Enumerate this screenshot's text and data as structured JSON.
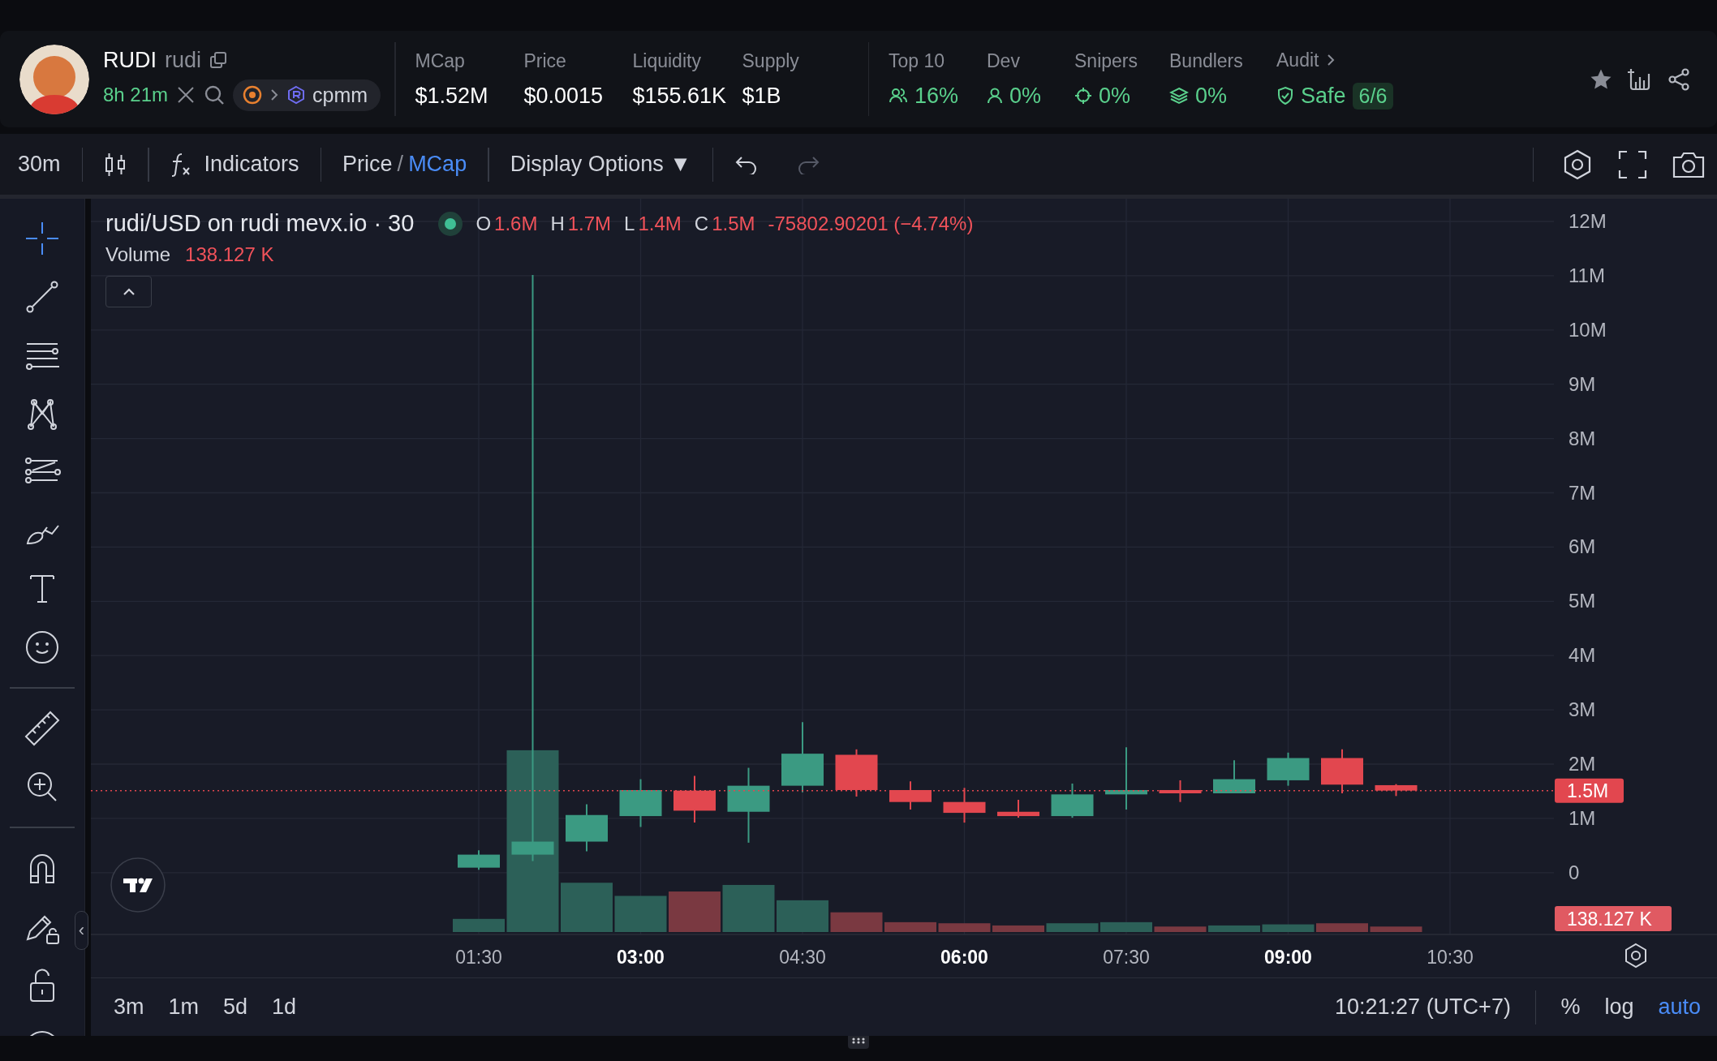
{
  "token": {
    "symbol": "RUDI",
    "name": "rudi",
    "age": "8h 21m",
    "pool": "cpmm"
  },
  "market_stats": [
    {
      "label": "MCap",
      "value": "$1.52M"
    },
    {
      "label": "Price",
      "value": "$0.0015"
    },
    {
      "label": "Liquidity",
      "value": "$155.61K"
    },
    {
      "label": "Supply",
      "value": "$1B"
    }
  ],
  "holder_stats": [
    {
      "label": "Top 10",
      "value": "16%"
    },
    {
      "label": "Dev",
      "value": "0%"
    },
    {
      "label": "Snipers",
      "value": "0%"
    },
    {
      "label": "Bundlers",
      "value": "0%"
    }
  ],
  "audit": {
    "label": "Audit",
    "status": "Safe",
    "score": "6/6"
  },
  "toolbar": {
    "interval": "30m",
    "indicators": "Indicators",
    "price_mode_separator": "/",
    "price_mode": [
      {
        "label": "Price",
        "selected": false
      },
      {
        "label": "MCap",
        "selected": true
      }
    ],
    "display_options": "Display Options ▼",
    "undo": {
      "disabled": false
    },
    "redo": {
      "disabled": true
    }
  },
  "drawing_tool_groups": [
    {
      "tools": [
        {
          "selected": true
        },
        {
          "selected": false
        },
        {
          "selected": false
        },
        {
          "selected": false
        },
        {
          "selected": false
        },
        {
          "selected": false
        },
        {
          "selected": false
        },
        {
          "selected": false
        }
      ]
    },
    {
      "tools": [
        {
          "selected": false
        },
        {
          "selected": false
        }
      ]
    },
    {
      "tools": [
        {
          "selected": false
        },
        {
          "selected": false
        },
        {
          "selected": false
        },
        {
          "selected": false
        }
      ]
    }
  ],
  "collapse_handle": "‹",
  "legend": {
    "title": "rudi/USD on rudi mevx.io · 30",
    "live": true,
    "ohlc": [
      {
        "key": "O",
        "value": "1.6M"
      },
      {
        "key": "H",
        "value": "1.7M"
      },
      {
        "key": "L",
        "value": "1.4M"
      },
      {
        "key": "C",
        "value": "1.5M"
      }
    ],
    "change": "-75802.90201 (−4.74%)",
    "volume_label": "Volume",
    "volume_value": "138.127 K"
  },
  "chart": {
    "kind": "picture",
    "last_price_label": "1.5M",
    "last_volume_label": "138.127 K",
    "price_axis": [
      "12M",
      "11M",
      "10M",
      "9M",
      "8M",
      "7M",
      "6M",
      "5M",
      "4M",
      "3M",
      "2M",
      "1M",
      "0"
    ],
    "time_axis": [
      {
        "label": "01:30",
        "bold": false
      },
      {
        "label": "03:00",
        "bold": true
      },
      {
        "label": "04:30",
        "bold": false
      },
      {
        "label": "06:00",
        "bold": true
      },
      {
        "label": "07:30",
        "bold": false
      },
      {
        "label": "09:00",
        "bold": true
      },
      {
        "label": "10:30",
        "bold": false
      }
    ]
  },
  "bottom_bar": {
    "ranges": [
      "3m",
      "1m",
      "5d",
      "1d"
    ],
    "clock": "10:21:27 (UTC+7)",
    "toggles": [
      {
        "label": "%",
        "selected": false
      },
      {
        "label": "log",
        "selected": false
      },
      {
        "label": "auto",
        "selected": true
      }
    ]
  }
}
